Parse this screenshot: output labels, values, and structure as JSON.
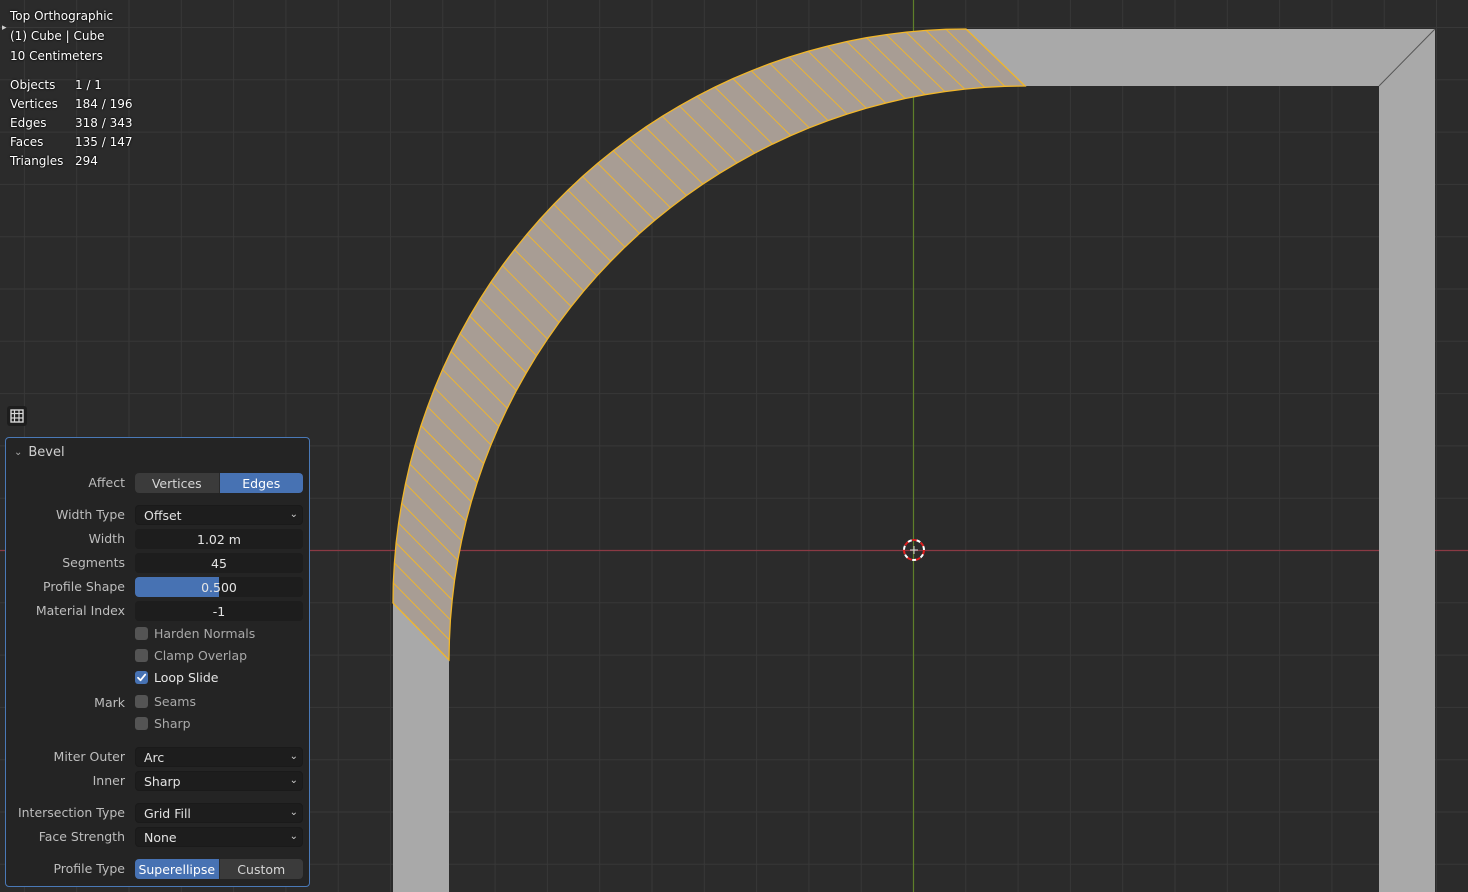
{
  "viewport": {
    "view_name": "Top Orthographic",
    "object_info": "(1) Cube | Cube",
    "grid_scale": "10 Centimeters",
    "stats": [
      {
        "label": "Objects",
        "value": "1 / 1"
      },
      {
        "label": "Vertices",
        "value": "184 / 196"
      },
      {
        "label": "Edges",
        "value": "318 / 343"
      },
      {
        "label": "Faces",
        "value": "135 / 147"
      },
      {
        "label": "Triangles",
        "value": "294"
      }
    ],
    "colors": {
      "background": "#2b2b2b",
      "grid": "#383838",
      "x_axis": "#8a3a44",
      "y_axis": "#5e7f2a",
      "mesh_face": "#a9a9a9",
      "selected_face": "#a89d94",
      "selection_edge": "#f2b72a"
    }
  },
  "bevel_panel": {
    "title": "Bevel",
    "affect": {
      "label": "Affect",
      "options": [
        "Vertices",
        "Edges"
      ],
      "selected": "Edges"
    },
    "width_type": {
      "label": "Width Type",
      "value": "Offset"
    },
    "width": {
      "label": "Width",
      "value": "1.02 m"
    },
    "segments": {
      "label": "Segments",
      "value": "45"
    },
    "profile_shape": {
      "label": "Profile Shape",
      "value": "0.500",
      "fraction": 0.5
    },
    "material_index": {
      "label": "Material Index",
      "value": "-1"
    },
    "harden_normals": {
      "label": "Harden Normals",
      "checked": false
    },
    "clamp_overlap": {
      "label": "Clamp Overlap",
      "checked": false
    },
    "loop_slide": {
      "label": "Loop Slide",
      "checked": true
    },
    "mark": {
      "label": "Mark",
      "seams": {
        "label": "Seams",
        "checked": false
      },
      "sharp": {
        "label": "Sharp",
        "checked": false
      }
    },
    "miter_outer": {
      "label": "Miter Outer",
      "value": "Arc"
    },
    "inner": {
      "label": "Inner",
      "value": "Sharp"
    },
    "intersection_type": {
      "label": "Intersection Type",
      "value": "Grid Fill"
    },
    "face_strength": {
      "label": "Face Strength",
      "value": "None"
    },
    "profile_type": {
      "label": "Profile Type",
      "options": [
        "Superellipse",
        "Custom"
      ],
      "selected": "Superellipse"
    }
  }
}
